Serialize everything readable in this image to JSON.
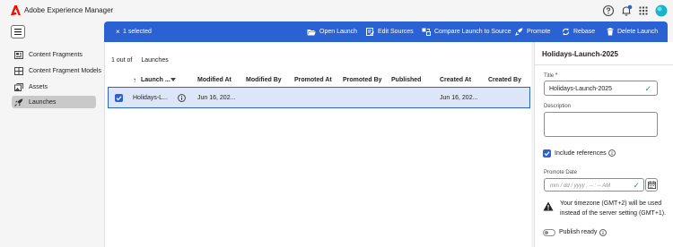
{
  "shell": {
    "app_title": "Adobe Experience Manager"
  },
  "nav": {
    "items": [
      {
        "label": "Content Fragments",
        "icon": "content-fragments-icon",
        "active": false
      },
      {
        "label": "Content Fragment Models",
        "icon": "fragment-models-icon",
        "active": false
      },
      {
        "label": "Assets",
        "icon": "assets-icon",
        "active": false
      },
      {
        "label": "Launches",
        "icon": "launches-icon",
        "active": true
      }
    ]
  },
  "actionbar": {
    "close": "×",
    "selected": "1 selected",
    "actions": [
      {
        "label": "Open Launch",
        "icon": "folder-open-icon"
      },
      {
        "label": "Edit Sources",
        "icon": "edit-sources-icon"
      },
      {
        "label": "Compare Launch to Source",
        "icon": "compare-icon"
      },
      {
        "label": "Promote",
        "icon": "promote-icon"
      },
      {
        "label": "Rebase",
        "icon": "rebase-icon"
      },
      {
        "label": "Delete Launch",
        "icon": "delete-icon"
      }
    ]
  },
  "list": {
    "count_text": "1 out of",
    "count_label": "Launches",
    "columns": [
      "Launch ...",
      "Modified At",
      "Modified By",
      "Promoted At",
      "Promoted By",
      "Published",
      "Created At",
      "Created By"
    ],
    "rows": [
      {
        "launch": "Holidays-L...",
        "modified_at": "Jun 16, 202...",
        "modified_by": "",
        "promoted_at": "",
        "promoted_by": "",
        "published": "",
        "created_at": "Jun 16, 202...",
        "created_by": "",
        "selected": true
      }
    ]
  },
  "panel": {
    "title": "Holidays-Launch-2025",
    "title_label": "Title",
    "title_value": "Holidays-Launch-2025",
    "description_label": "Description",
    "description_value": "",
    "include_references_label": "Include references",
    "include_references": true,
    "promote_date_label": "Promote Date",
    "promote_date_placeholder": "mm / dd / yyyy ,  -- : --  AM",
    "timezone_warning_line1": "Your timezone (GMT+2) will be used",
    "timezone_warning_line2": "instead of the server setting (GMT+1).",
    "publish_ready_label": "Publish ready",
    "publish_ready": false
  },
  "colors": {
    "accent": "#2a62d4",
    "valid": "#2d9d78",
    "adobe_red": "#eb1000"
  }
}
